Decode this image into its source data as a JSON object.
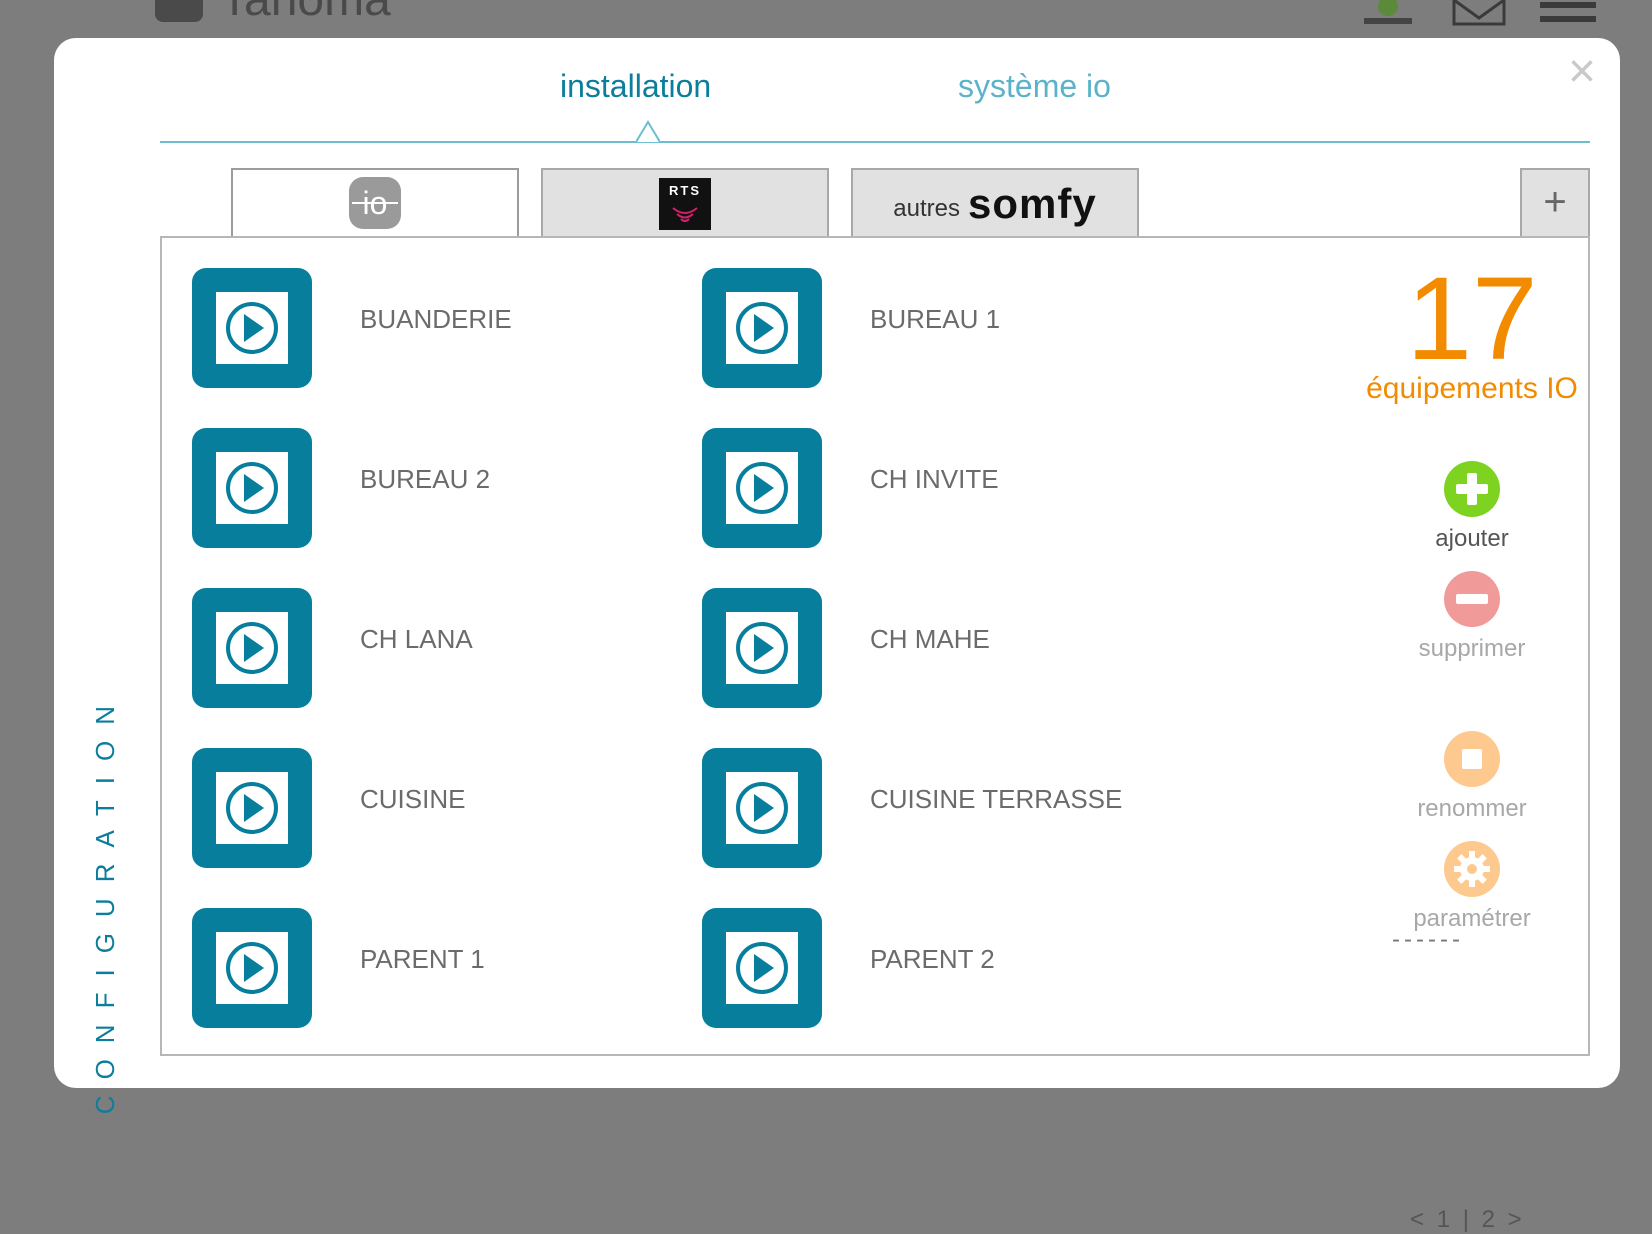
{
  "app": {
    "logo_text": "Tahoma"
  },
  "tabs": [
    {
      "label": "installation",
      "active": true
    },
    {
      "label": "système io",
      "active": false
    }
  ],
  "categories": [
    {
      "name": "io",
      "icon": "io-logo-icon",
      "active": true
    },
    {
      "name": "RTS",
      "icon": "rts-logo-icon",
      "active": false
    },
    {
      "prefix": "autres",
      "brand": "somfy",
      "icon": "somfy-logo-icon",
      "active": false
    }
  ],
  "add_category": "+",
  "side_label": "CONFIGURATION",
  "devices": [
    {
      "name": "BUANDERIE"
    },
    {
      "name": "BUREAU 1"
    },
    {
      "name": "BUREAU 2"
    },
    {
      "name": "CH INVITE"
    },
    {
      "name": "CH LANA"
    },
    {
      "name": "CH MAHE"
    },
    {
      "name": "CUISINE"
    },
    {
      "name": "CUISINE TERRASSE"
    },
    {
      "name": "PARENT 1"
    },
    {
      "name": "PARENT 2"
    }
  ],
  "summary": {
    "count": "17",
    "label": "équipements IO"
  },
  "actions": [
    {
      "label": "ajouter",
      "icon": "add-icon",
      "color": "#7ed321"
    },
    {
      "label": "supprimer",
      "icon": "remove-icon",
      "color": "#f09a9a"
    },
    {
      "label": "renommer",
      "icon": "rename-icon",
      "color": "#fdc98f"
    },
    {
      "label": "paramétrer",
      "icon": "settings-icon",
      "color": "#fdc98f"
    }
  ],
  "separator": "------",
  "pagination": {
    "prev": "<",
    "page1": "1",
    "sep": "|",
    "page2": "2",
    "next": ">"
  },
  "colors": {
    "accent": "#0b7e9c",
    "device_tile": "#077f9c",
    "count": "#f28b00"
  }
}
